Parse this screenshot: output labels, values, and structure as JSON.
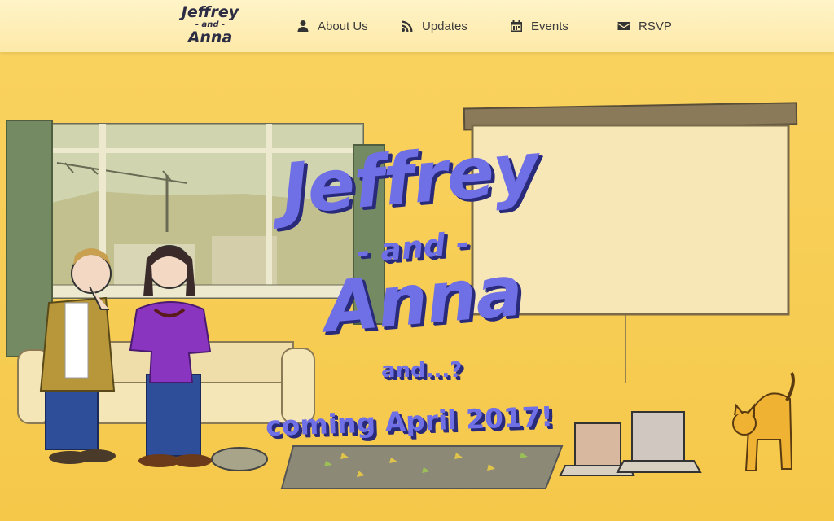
{
  "brand": {
    "line1": "Jeffrey",
    "line2": "- and -",
    "line3": "Anna"
  },
  "nav": [
    {
      "label": "About Us",
      "icon": "user-icon"
    },
    {
      "label": "Updates",
      "icon": "rss-icon"
    },
    {
      "label": "Events",
      "icon": "calendar-icon"
    },
    {
      "label": "RSVP",
      "icon": "envelope-icon"
    }
  ],
  "hero": {
    "title1": "Jeffrey",
    "conjunction": "- and -",
    "title2": "Anna",
    "question": "and...?",
    "announcement": "coming April 2017!"
  },
  "colors": {
    "background": "#f8cf57",
    "title": "#6f6fe6",
    "title_shadow": "#2a2a7a",
    "nav_text": "#3b3b3b"
  }
}
